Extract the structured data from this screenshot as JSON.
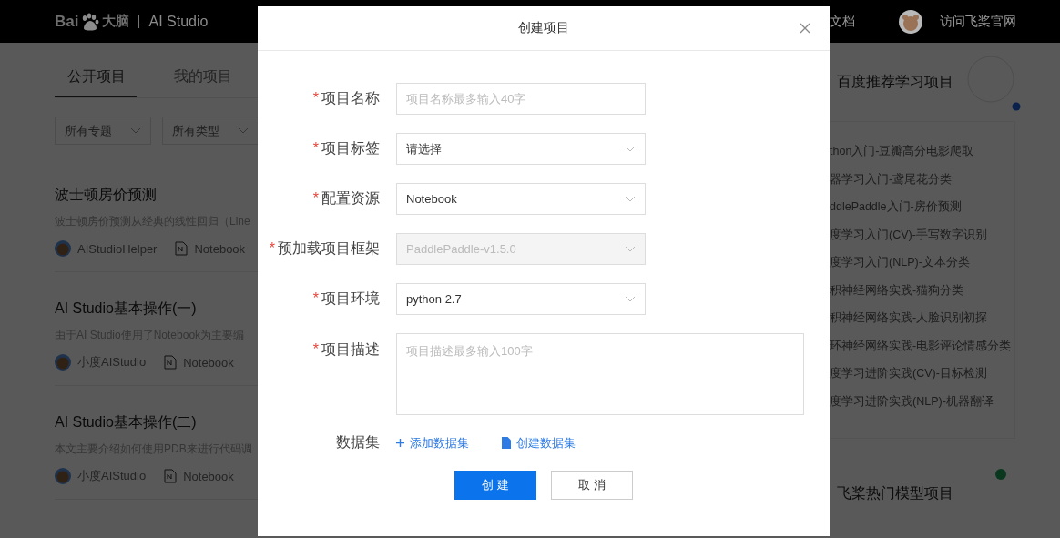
{
  "header": {
    "logo": [
      "Bai",
      "大脑"
    ],
    "product": "AI Studio",
    "nav_fragment": "文档",
    "site_link": "访问飞桨官网"
  },
  "tabs": [
    {
      "label": "公开项目",
      "selected": true
    },
    {
      "label": "我的项目",
      "selected": false
    }
  ],
  "filters": [
    {
      "label": "所有专题"
    },
    {
      "label": "所有类型"
    }
  ],
  "projects": [
    {
      "title": "波士顿房价预测",
      "description": "波士顿房价预测从经典的线性回归（Line",
      "author": "AIStudioHelper",
      "type": "Notebook"
    },
    {
      "title": "AI Studio基本操作(一)",
      "description": "由于AI Studio使用了Notebook为主要编",
      "author": "小度AIStudio",
      "type": "Notebook"
    },
    {
      "title": "AI Studio基本操作(二)",
      "description": "本文主要介绍如何使用PDB来进行代码调",
      "author": "小度AIStudio",
      "type": "Notebook"
    }
  ],
  "recommend": {
    "title": "百度推荐学习项目",
    "items": [
      "thon入门-豆瓣高分电影爬取",
      "器学习入门-鸢尾花分类",
      "ddlePaddle入门-房价预测",
      "度学习入门(CV)-手写数字识别",
      "度学习入门(NLP)-文本分类",
      "积神经网络实践-猫狗分类",
      "积神经网络实践-人脸识别初探",
      "环神经网络实践-电影评论情感分类",
      "度学习进阶实践(CV)-目标检测",
      "度学习进阶实践(NLP)-机器翻译"
    ]
  },
  "hot": {
    "title": "飞桨热门模型项目"
  },
  "dialog": {
    "title": "创建项目",
    "fields": [
      {
        "kind": "text",
        "label": "项目名称",
        "required_mark": "*",
        "placeholder": "项目名称最多输入40字"
      },
      {
        "kind": "select",
        "label": "项目标签",
        "required_mark": "*",
        "value": "请选择",
        "disabled": false
      },
      {
        "kind": "select",
        "label": "配置资源",
        "required_mark": "*",
        "value": "Notebook",
        "disabled": false
      },
      {
        "kind": "select",
        "label": "预加载项目框架",
        "required_mark": "*",
        "value": "PaddlePaddle-v1.5.0",
        "disabled": true
      },
      {
        "kind": "select",
        "label": "项目环境",
        "required_mark": "*",
        "value": "python 2.7",
        "disabled": false
      },
      {
        "kind": "textarea",
        "label": "项目描述",
        "required_mark": "*",
        "placeholder": "项目描述最多输入100字"
      }
    ],
    "dataset": {
      "label": "数据集",
      "links": [
        {
          "kind": "add",
          "label": "添加数据集"
        },
        {
          "kind": "create",
          "label": "创建数据集"
        }
      ]
    },
    "buttons": [
      {
        "kind": "primary",
        "label": "创 建"
      },
      {
        "kind": "default",
        "label": "取 消"
      }
    ]
  }
}
